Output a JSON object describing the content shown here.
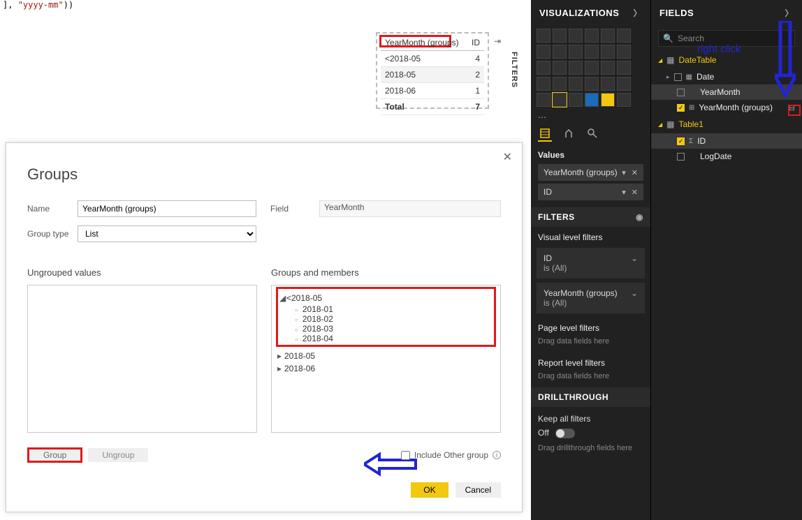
{
  "formula": {
    "suffix_text": "], \"yyyy-mm\"))"
  },
  "visual_table": {
    "headers": [
      "YearMonth (groups)",
      "ID"
    ],
    "rows": [
      {
        "label": "<2018-05",
        "value": 4
      },
      {
        "label": "2018-05",
        "value": 2
      },
      {
        "label": "2018-06",
        "value": 1
      }
    ],
    "total_label": "Total",
    "total_value": 7
  },
  "filters_tab_label": "FILTERS",
  "dialog": {
    "title": "Groups",
    "name_label": "Name",
    "name_value": "YearMonth (groups)",
    "field_label": "Field",
    "field_value": "YearMonth",
    "group_type_label": "Group type",
    "group_type_value": "List",
    "ungrouped_label": "Ungrouped values",
    "groups_label": "Groups and members",
    "members": {
      "expanded": {
        "name": "<2018-05",
        "children": [
          "2018-01",
          "2018-02",
          "2018-03",
          "2018-04"
        ]
      },
      "collapsed": [
        "2018-05",
        "2018-06"
      ]
    },
    "group_btn": "Group",
    "ungroup_btn": "Ungroup",
    "include_other_label": "Include Other group",
    "ok": "OK",
    "cancel": "Cancel"
  },
  "viz": {
    "title": "VISUALIZATIONS",
    "values_label": "Values",
    "wells": [
      {
        "name": "YearMonth (groups)"
      },
      {
        "name": "ID"
      }
    ],
    "filters_label": "FILTERS",
    "visual_filters_label": "Visual level filters",
    "filters": [
      {
        "name": "ID",
        "desc": "is (All)"
      },
      {
        "name": "YearMonth (groups)",
        "desc": "is (All)"
      }
    ],
    "page_filters_label": "Page level filters",
    "report_filters_label": "Report level filters",
    "drop_hint": "Drag data fields here",
    "drill_label": "DRILLTHROUGH",
    "keep_all_label": "Keep all filters",
    "off_label": "Off",
    "drill_hint": "Drag drillthrough fields here"
  },
  "fields": {
    "title": "FIELDS",
    "search_placeholder": "Search",
    "tables": [
      {
        "name": "DateTable",
        "fields": [
          {
            "name": "Date",
            "checked": false,
            "icon": "date",
            "selected": false
          },
          {
            "name": "YearMonth",
            "checked": false,
            "icon": "",
            "selected": true
          },
          {
            "name": "YearMonth (groups)",
            "checked": true,
            "icon": "group",
            "selected": false,
            "trailing": true
          }
        ]
      },
      {
        "name": "Table1",
        "fields": [
          {
            "name": "ID",
            "checked": true,
            "icon": "sigma",
            "selected": false
          },
          {
            "name": "LogDate",
            "checked": false,
            "icon": "",
            "selected": false
          }
        ]
      }
    ]
  },
  "annotations": {
    "right_click": "right click"
  }
}
